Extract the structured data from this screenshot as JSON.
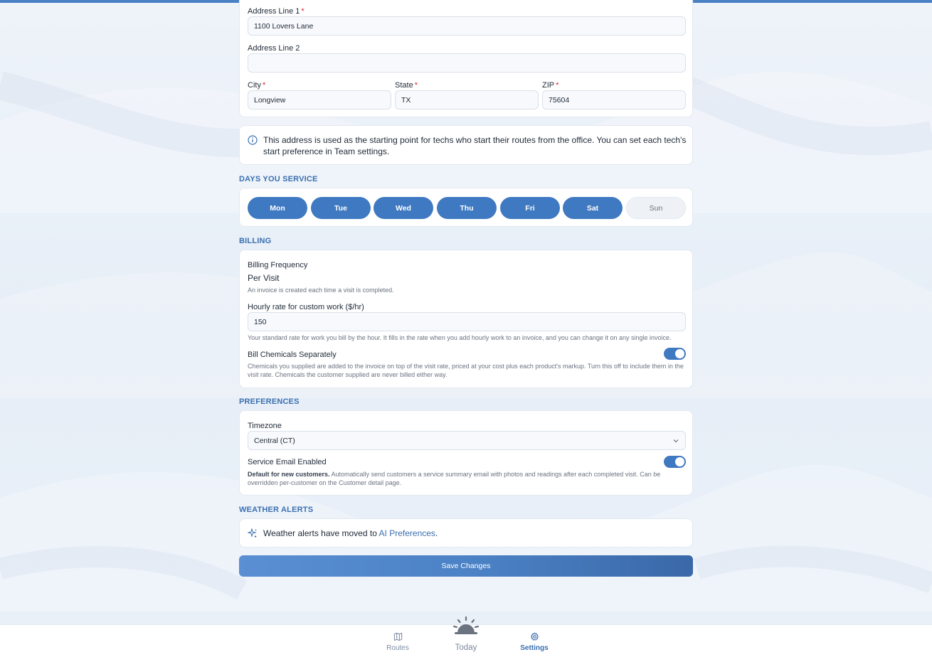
{
  "address": {
    "line1_label": "Address Line 1",
    "line1_value": "1100 Lovers Lane",
    "line2_label": "Address Line 2",
    "line2_value": "",
    "city_label": "City",
    "city_value": "Longview",
    "state_label": "State",
    "state_value": "TX",
    "zip_label": "ZIP",
    "zip_value": "75604",
    "required_mark": "*"
  },
  "info": {
    "text": "This address is used as the starting point for techs who start their routes from the office. You can set each tech's start preference in Team settings."
  },
  "days": {
    "title": "DAYS YOU SERVICE",
    "items": [
      {
        "label": "Mon",
        "selected": true
      },
      {
        "label": "Tue",
        "selected": true
      },
      {
        "label": "Wed",
        "selected": true
      },
      {
        "label": "Thu",
        "selected": true
      },
      {
        "label": "Fri",
        "selected": true
      },
      {
        "label": "Sat",
        "selected": true
      },
      {
        "label": "Sun",
        "selected": false
      }
    ]
  },
  "billing": {
    "title": "BILLING",
    "frequency_label": "Billing Frequency",
    "frequency_value": "Per Visit",
    "frequency_help": "An invoice is created each time a visit is completed.",
    "hourly_label": "Hourly rate for custom work ($/hr)",
    "hourly_value": "150",
    "hourly_help": "Your standard rate for work you bill by the hour. It fills in the rate when you add hourly work to an invoice, and you can change it on any single invoice.",
    "chemicals_label": "Bill Chemicals Separately",
    "chemicals_enabled": true,
    "chemicals_help": "Chemicals you supplied are added to the invoice on top of the visit rate, priced at your cost plus each product's markup. Turn this off to include them in the visit rate. Chemicals the customer supplied are never billed either way."
  },
  "preferences": {
    "title": "PREFERENCES",
    "timezone_label": "Timezone",
    "timezone_value": "Central (CT)",
    "email_label": "Service Email Enabled",
    "email_enabled": true,
    "email_help_strong": "Default for new customers.",
    "email_help": " Automatically send customers a service summary email with photos and readings after each completed visit. Can be overridden per-customer on the Customer detail page."
  },
  "weather": {
    "title": "WEATHER ALERTS",
    "text_before": "Weather alerts have moved to ",
    "link": "AI Preferences",
    "text_after": "."
  },
  "save_label": "Save Changes",
  "nav": {
    "routes": "Routes",
    "today": "Today",
    "settings": "Settings"
  },
  "colors": {
    "accent": "#3f79c1",
    "section_title": "#3a6fb0",
    "required": "#dc2626"
  }
}
